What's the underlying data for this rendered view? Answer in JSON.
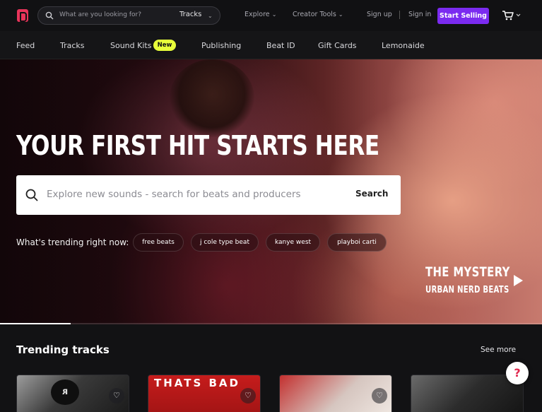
{
  "header": {
    "search": {
      "placeholder": "What are you looking for?",
      "scope": "Tracks"
    },
    "nav": {
      "explore": "Explore",
      "creator_tools": "Creator Tools"
    },
    "auth": {
      "sign_up": "Sign up",
      "sign_in": "Sign in"
    },
    "start_selling": "Start Selling"
  },
  "subnav": {
    "items": [
      "Feed",
      "Tracks",
      "Sound Kits",
      "Publishing",
      "Beat ID",
      "Gift Cards",
      "Lemonaide"
    ],
    "new_badge": "New"
  },
  "hero": {
    "headline": "YOUR FIRST HIT STARTS HERE",
    "search_placeholder": "Explore new sounds - search for beats and producers",
    "search_button": "Search",
    "trending_label": "What's trending right now:",
    "chips": [
      "free beats",
      "j cole type beat",
      "kanye west",
      "playboi carti"
    ],
    "featured": {
      "title": "THE MYSTERY",
      "artist": "URBAN NERD BEATS"
    },
    "carousel_progress": 0.13
  },
  "trending": {
    "title": "Trending tracks",
    "see_more": "See more",
    "cards": [
      {
        "caption": ""
      },
      {
        "caption": "THATS BAD"
      },
      {
        "caption": ""
      },
      {
        "caption": ""
      }
    ]
  },
  "help": "?",
  "colors": {
    "brand": "#e8345a",
    "accent": "#7b2bf0",
    "badge": "#e8ff3a"
  }
}
